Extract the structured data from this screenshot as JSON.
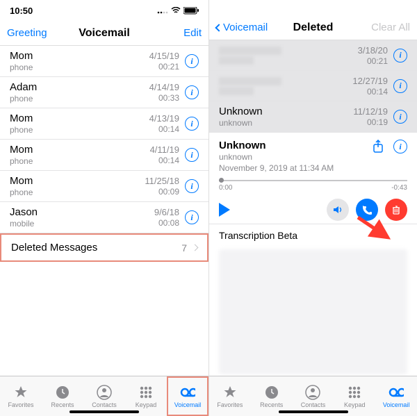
{
  "left": {
    "status_time": "10:50",
    "nav": {
      "left": "Greeting",
      "title": "Voicemail",
      "right": "Edit"
    },
    "rows": [
      {
        "caller": "Mom",
        "source": "phone",
        "date": "4/15/19",
        "dur": "00:21"
      },
      {
        "caller": "Adam",
        "source": "phone",
        "date": "4/14/19",
        "dur": "00:33"
      },
      {
        "caller": "Mom",
        "source": "phone",
        "date": "4/13/19",
        "dur": "00:14"
      },
      {
        "caller": "Mom",
        "source": "phone",
        "date": "4/11/19",
        "dur": "00:14"
      },
      {
        "caller": "Mom",
        "source": "phone",
        "date": "11/25/18",
        "dur": "00:09"
      },
      {
        "caller": "Jason",
        "source": "mobile",
        "date": "9/6/18",
        "dur": "00:08"
      }
    ],
    "deleted": {
      "label": "Deleted Messages",
      "count": "7"
    }
  },
  "right": {
    "nav": {
      "back": "Voicemail",
      "title": "Deleted",
      "right": "Clear All"
    },
    "grey_rows": [
      {
        "date": "3/18/20",
        "dur": "00:21"
      },
      {
        "date": "12/27/19",
        "dur": "00:14"
      },
      {
        "caller": "Unknown",
        "source": "unknown",
        "date": "11/12/19",
        "dur": "00:19"
      }
    ],
    "detail": {
      "caller": "Unknown",
      "source": "unknown",
      "timestamp": "November 9, 2019 at 11:34 AM",
      "elapsed": "0:00",
      "remaining": "-0:43"
    },
    "transcription_label": "Transcription Beta"
  },
  "tabs": [
    {
      "label": "Favorites",
      "icon": "star-icon"
    },
    {
      "label": "Recents",
      "icon": "clock-icon"
    },
    {
      "label": "Contacts",
      "icon": "contact-icon"
    },
    {
      "label": "Keypad",
      "icon": "keypad-icon"
    },
    {
      "label": "Voicemail",
      "icon": "voicemail-icon"
    }
  ]
}
